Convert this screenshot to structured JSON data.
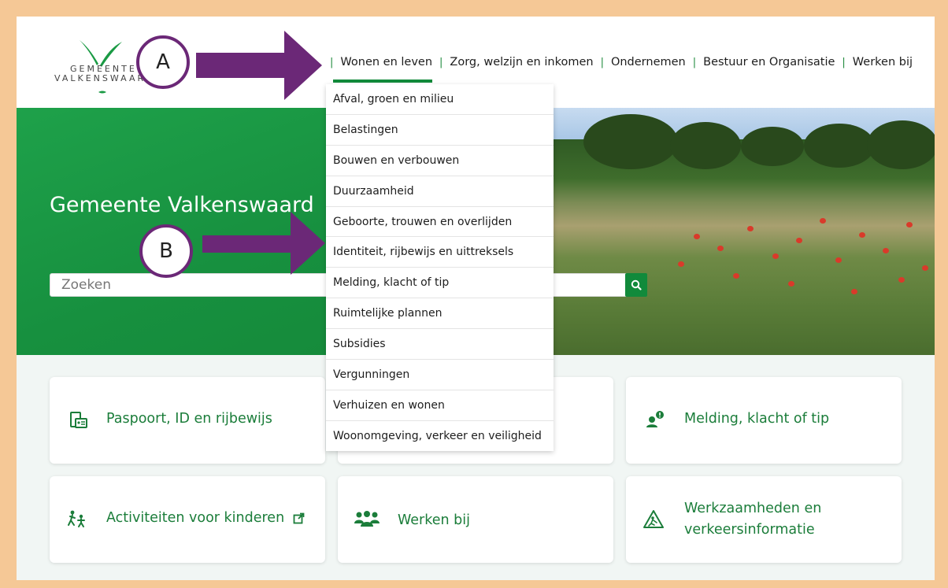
{
  "logo": {
    "line1": "GEMEENTE",
    "line2": "VALKENSWAARD"
  },
  "nav": {
    "items": [
      "Wonen en leven",
      "Zorg, welzijn en inkomen",
      "Ondernemen",
      "Bestuur en Organisatie",
      "Werken bij"
    ],
    "active": "Wonen en leven"
  },
  "hero": {
    "title": "Gemeente Valkenswaard"
  },
  "search": {
    "placeholder": "Zoeken"
  },
  "dropdown": {
    "items": [
      "Afval, groen en milieu",
      "Belastingen",
      "Bouwen en verbouwen",
      "Duurzaamheid",
      "Geboorte, trouwen en overlijden",
      "Identiteit, rijbewijs en uittreksels",
      "Melding, klacht of tip",
      "Ruimtelijke plannen",
      "Subsidies",
      "Vergunningen",
      "Verhuizen en wonen",
      "Woonomgeving, verkeer en veiligheid"
    ]
  },
  "cards": {
    "passport": "Paspoort, ID en rijbewijs",
    "melding": "Melding, klacht of tip",
    "kinderen": "Activiteiten voor kinderen",
    "werken": "Werken bij",
    "werkzaamheden_l1": "Werkzaamheden en",
    "werkzaamheden_l2": "verkeersinformatie"
  },
  "annotations": {
    "a": "A",
    "b": "B"
  },
  "colors": {
    "brand_green": "#118a3b",
    "annotation_purple": "#6b2877",
    "frame": "#f5c896"
  }
}
